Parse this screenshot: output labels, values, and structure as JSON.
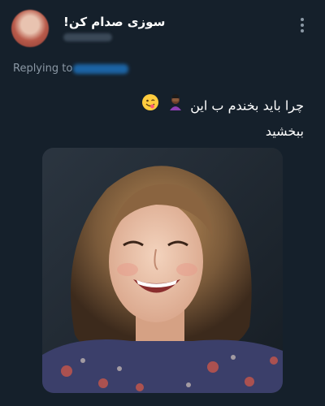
{
  "author": {
    "display_name": "سوزی صدام کن!",
    "avatar_icon": "avatar-photo",
    "handle_blurred": true
  },
  "reply": {
    "label": "Replying to",
    "mention_blurred": true
  },
  "tweet": {
    "line1": "چرا باید بخندم ب این",
    "line2": "ببخشید",
    "emojis": [
      "person-facepalming-icon",
      "face-savoring-food-icon"
    ]
  },
  "media": {
    "description_icon": "woman-laughing-photo"
  },
  "colors": {
    "background": "#15202b",
    "secondary_text": "#8b98a5",
    "primary_text": "#ffffff",
    "link": "#1d9bf0"
  }
}
